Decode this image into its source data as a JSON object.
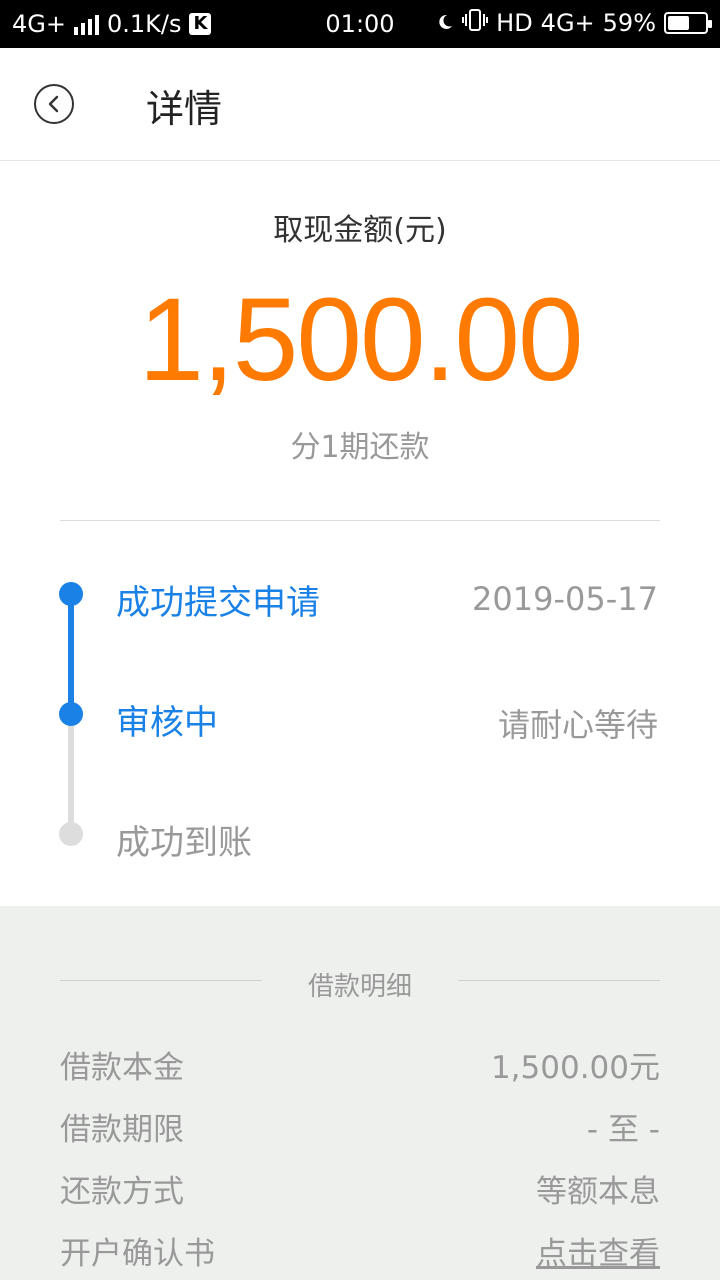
{
  "status_bar": {
    "network": "4G+",
    "speed": "0.1K/s",
    "k_badge": "K",
    "time": "01:00",
    "hd": "HD",
    "network2": "4G+",
    "battery": "59%",
    "battery_level": 0.59
  },
  "header": {
    "title": "详情"
  },
  "amount": {
    "label": "取现金额(元)",
    "value": "1,500.00",
    "installment": "分1期还款",
    "color": "#ff7a00"
  },
  "timeline": {
    "accent": "#1a82e6",
    "steps": [
      {
        "label": "成功提交申请",
        "right": "2019-05-17",
        "state": "active"
      },
      {
        "label": "审核中",
        "right": "请耐心等待",
        "state": "active"
      },
      {
        "label": "成功到账",
        "right": "",
        "state": "inactive"
      }
    ]
  },
  "details": {
    "title": "借款明细",
    "rows": [
      {
        "key": "借款本金",
        "value": "1,500.00元"
      },
      {
        "key": "借款期限",
        "value": "- 至 -"
      },
      {
        "key": "还款方式",
        "value": "等额本息"
      },
      {
        "key": "开户确认书",
        "value": "点击查看"
      }
    ]
  }
}
